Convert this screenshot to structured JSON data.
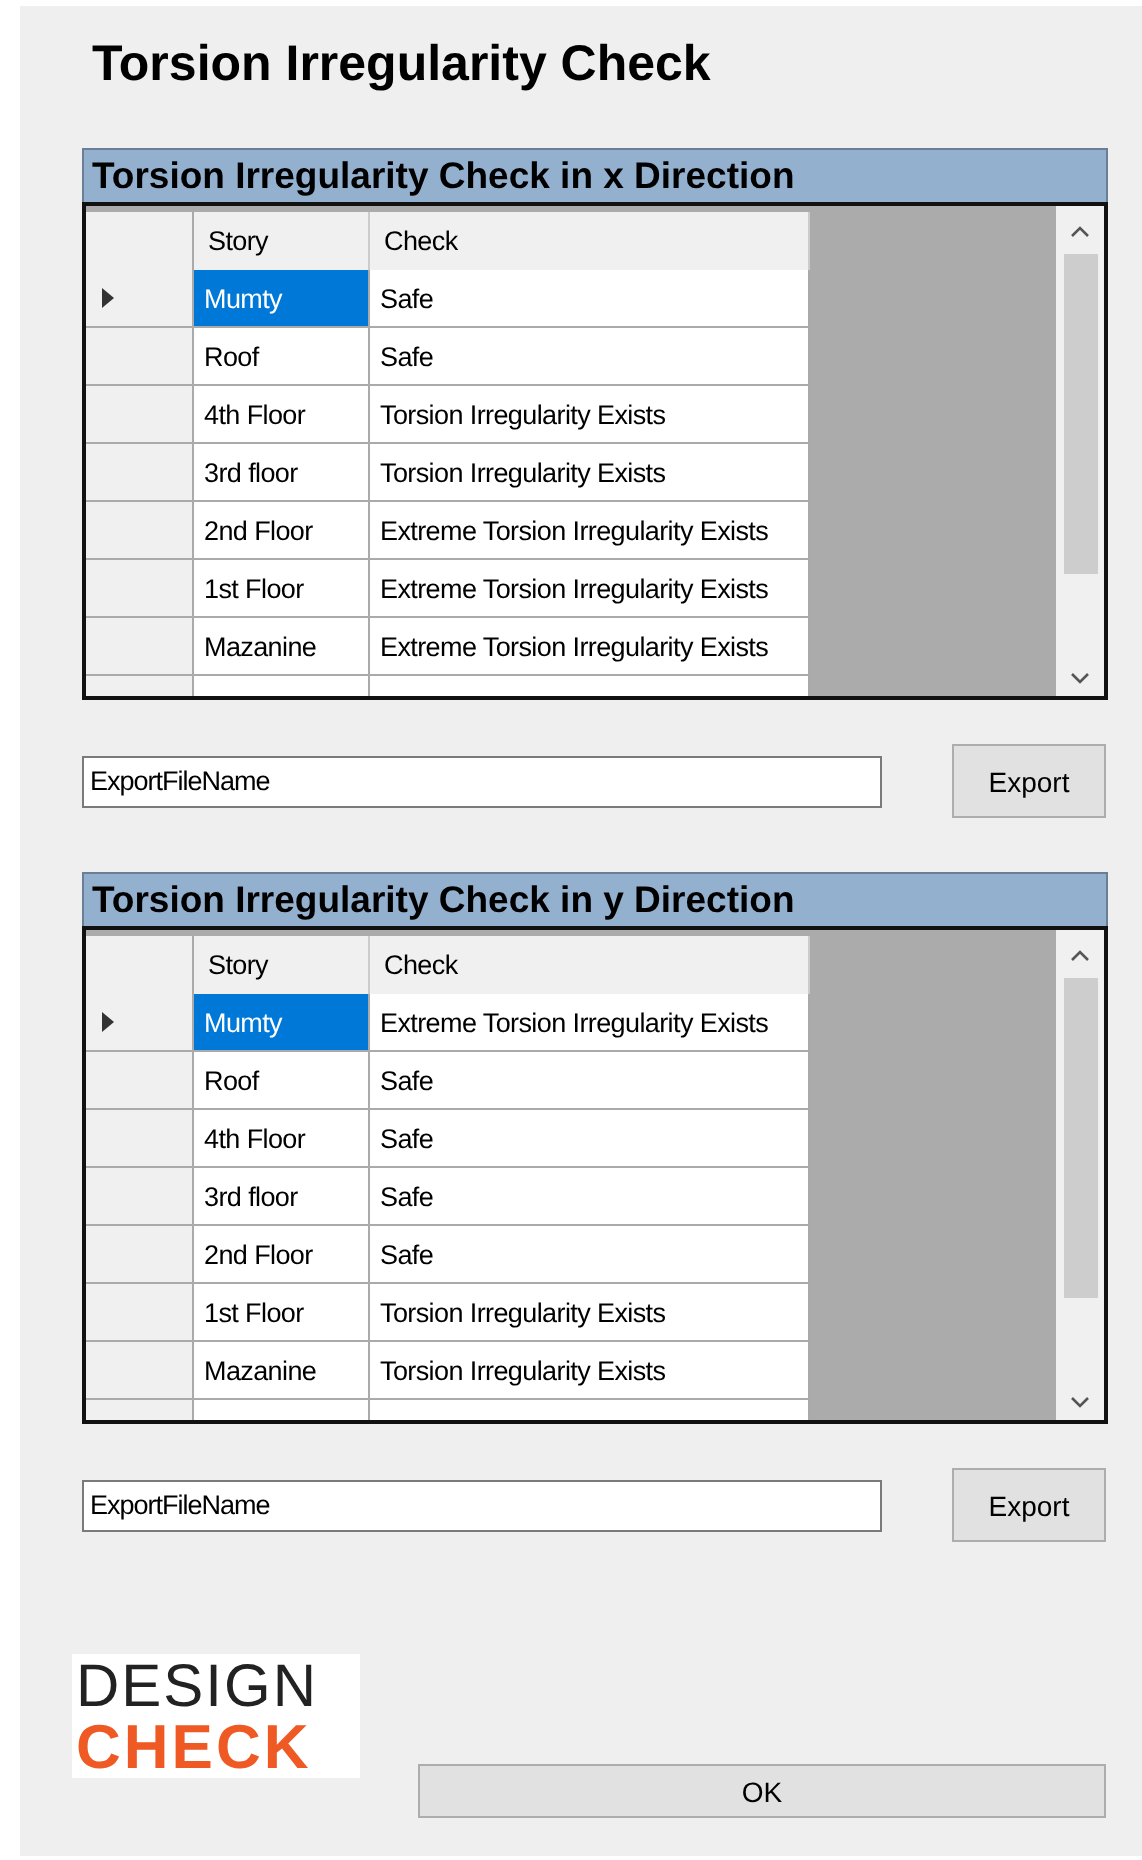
{
  "title": "Torsion Irregularity Check",
  "sections": [
    {
      "header": "Torsion Irregularity Check in x Direction",
      "columns": [
        "Story",
        "Check"
      ],
      "rows": [
        {
          "story": "Mumty",
          "check": "Safe",
          "selected": true
        },
        {
          "story": "Roof",
          "check": "Safe",
          "selected": false
        },
        {
          "story": "4th Floor",
          "check": "Torsion Irregularity Exists",
          "selected": false
        },
        {
          "story": "3rd floor",
          "check": "Torsion Irregularity Exists",
          "selected": false
        },
        {
          "story": "2nd Floor",
          "check": "Extreme Torsion Irregularity Exists",
          "selected": false
        },
        {
          "story": "1st Floor",
          "check": "Extreme Torsion Irregularity Exists",
          "selected": false
        },
        {
          "story": "Mazanine",
          "check": "Extreme Torsion Irregularity Exists",
          "selected": false
        }
      ],
      "export_field": "ExportFileName",
      "export_button": "Export"
    },
    {
      "header": "Torsion Irregularity Check in y Direction",
      "columns": [
        "Story",
        "Check"
      ],
      "rows": [
        {
          "story": "Mumty",
          "check": "Extreme Torsion Irregularity Exists",
          "selected": true
        },
        {
          "story": "Roof",
          "check": "Safe",
          "selected": false
        },
        {
          "story": "4th Floor",
          "check": "Safe",
          "selected": false
        },
        {
          "story": "3rd floor",
          "check": "Safe",
          "selected": false
        },
        {
          "story": "2nd Floor",
          "check": "Safe",
          "selected": false
        },
        {
          "story": "1st Floor",
          "check": "Torsion Irregularity Exists",
          "selected": false
        },
        {
          "story": "Mazanine",
          "check": "Torsion Irregularity Exists",
          "selected": false
        }
      ],
      "export_field": "ExportFileName",
      "export_button": "Export"
    }
  ],
  "logo": {
    "line_1": "DESIGN",
    "line_2": "CHECK"
  },
  "ok_button": "OK"
}
